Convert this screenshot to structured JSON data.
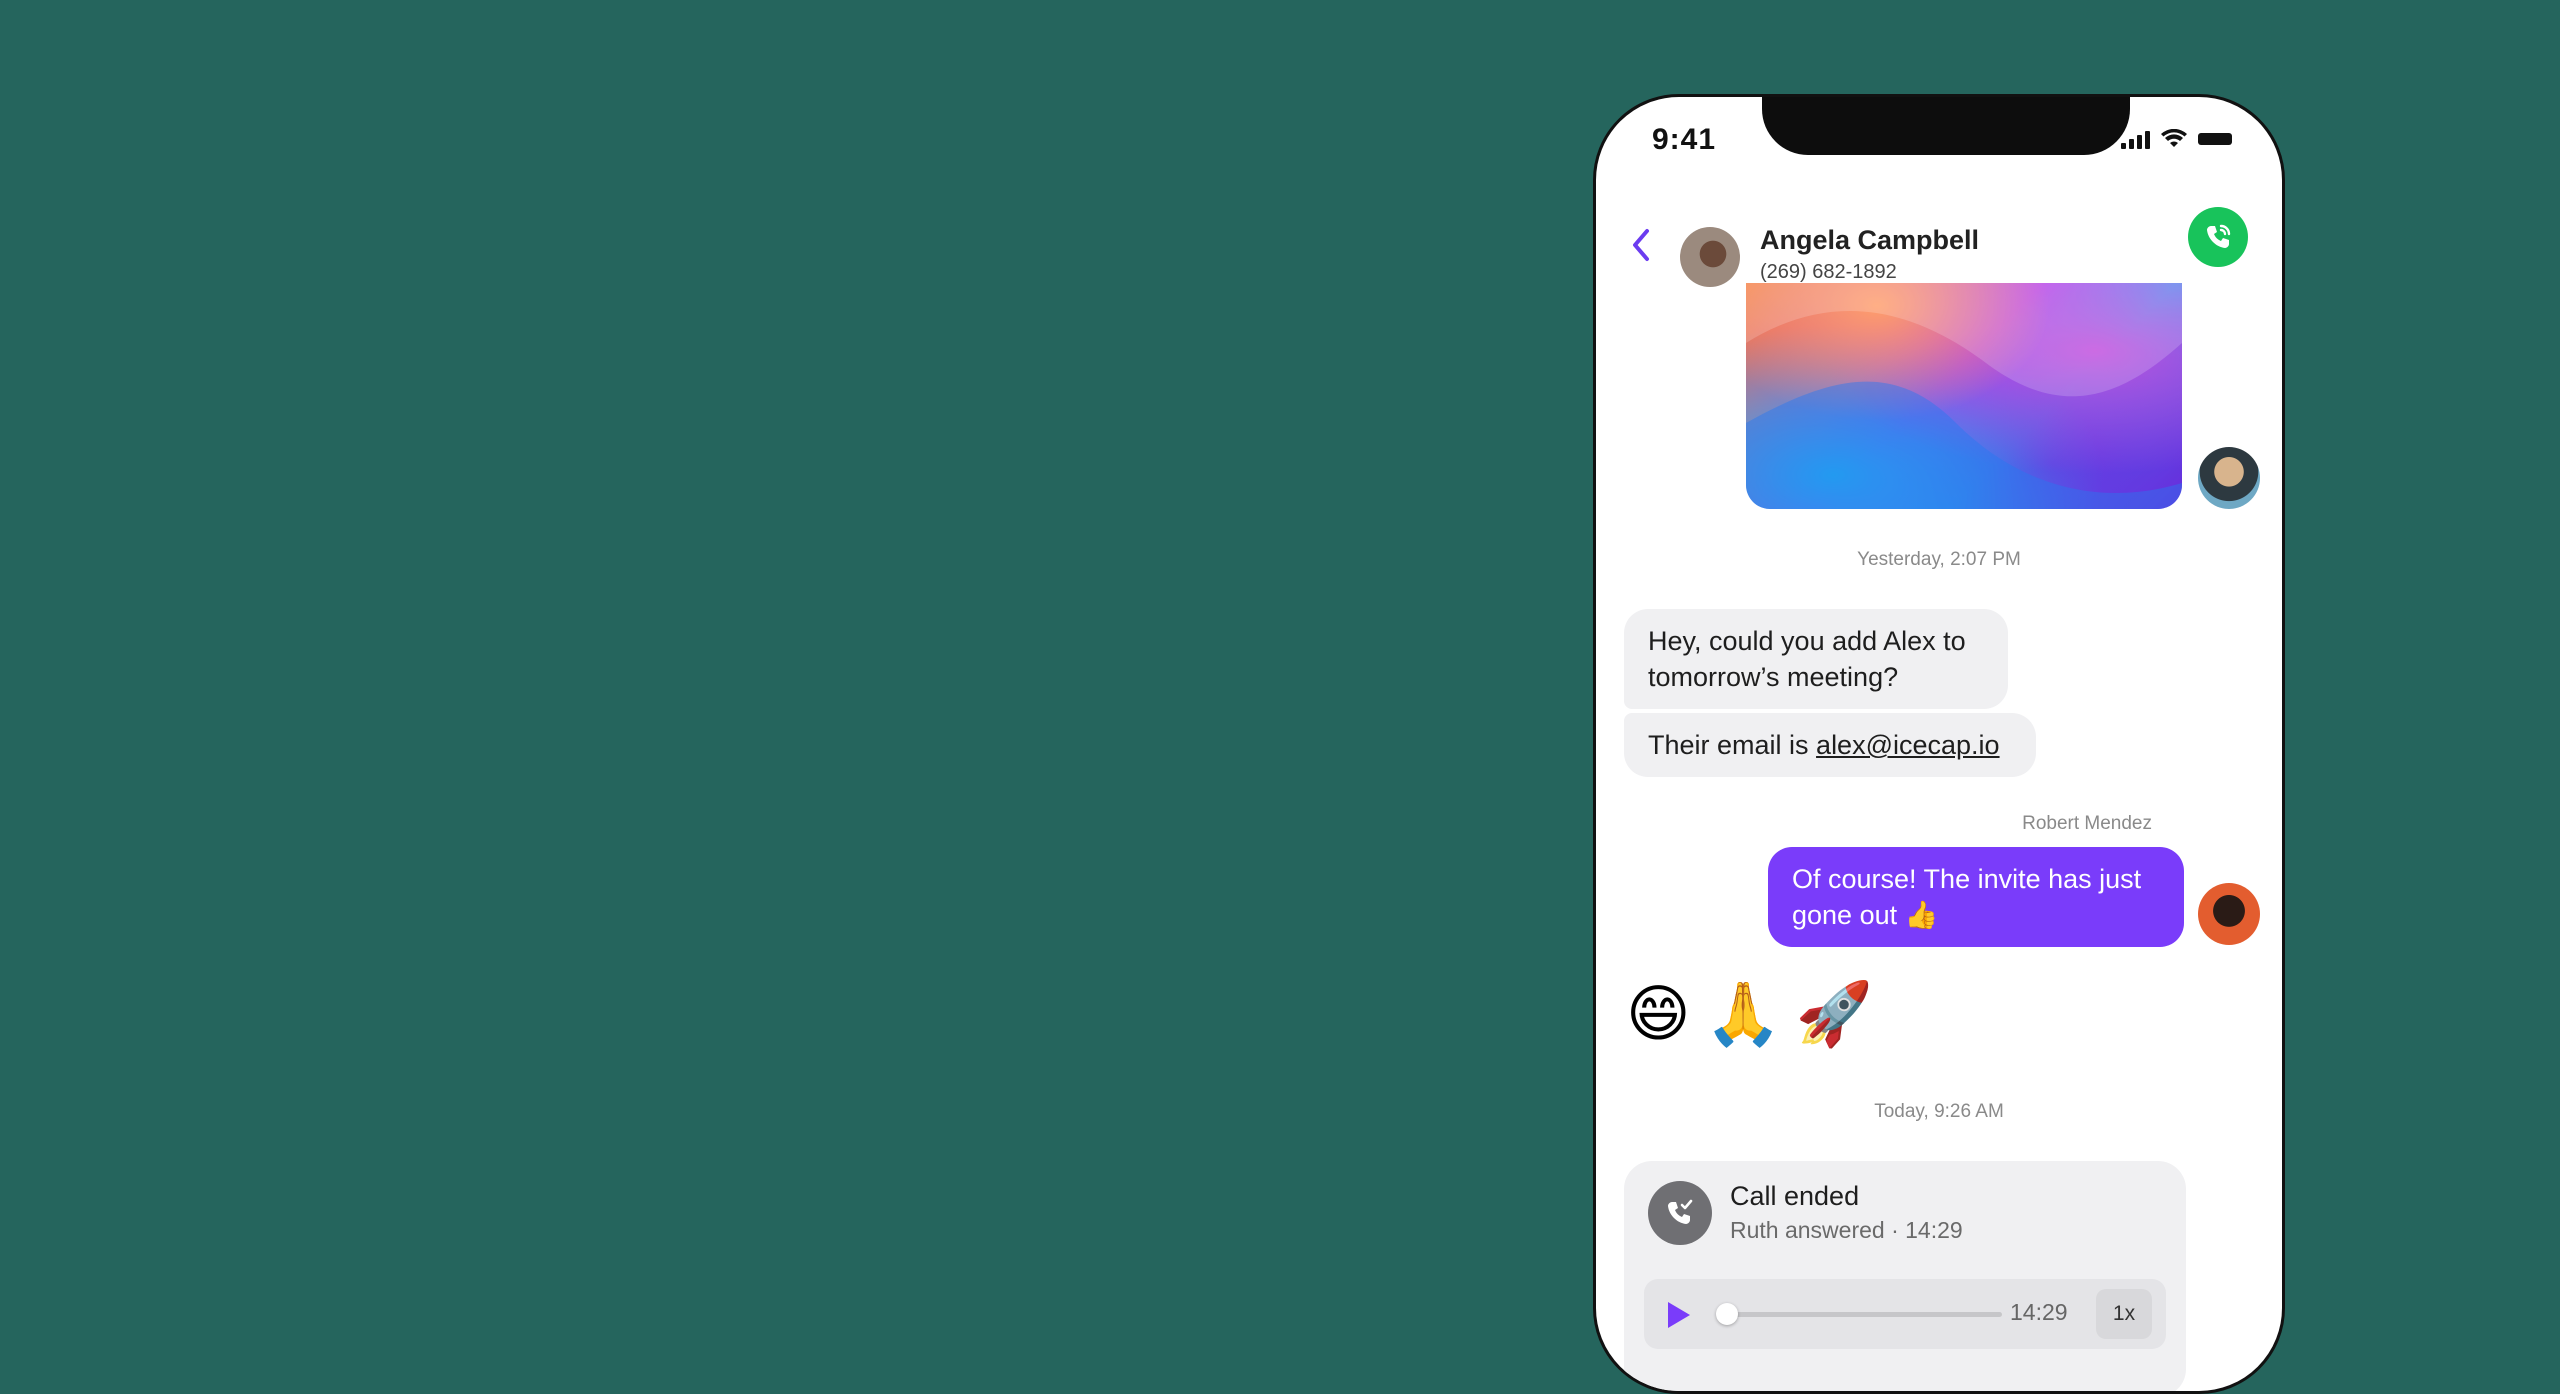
{
  "status_bar": {
    "time": "9:41"
  },
  "header": {
    "contact_name": "Angela Campbell",
    "contact_phone": "(269) 682-1892"
  },
  "messages": {
    "timestamp_1": "Yesterday, 2:07 PM",
    "bubble_1": "Hey, could you add Alex to tomorrow’s meeting?",
    "bubble_2_prefix": "Their email is ",
    "bubble_2_link": "alex@icecap.io",
    "sender_label": "Robert Mendez",
    "bubble_3": "Of course! The invite has just gone out 👍",
    "emojis": "😄🙏🚀",
    "timestamp_2": "Today, 9:26 AM"
  },
  "call_card": {
    "title": "Call ended",
    "subtitle": "Ruth answered · 14:29",
    "duration": "14:29",
    "speed": "1x",
    "progress": 0.0
  },
  "colors": {
    "background": "#25655d",
    "accent_purple": "#7a3cfa",
    "call_green": "#18c35b"
  }
}
